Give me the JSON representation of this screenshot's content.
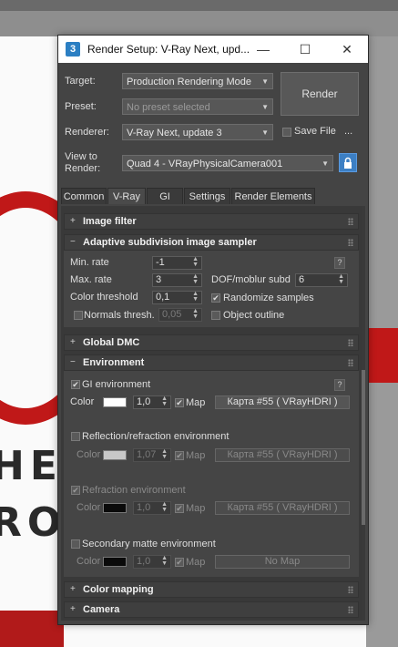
{
  "background": {
    "word_top": "HEL",
    "word_bottom": "ROU"
  },
  "window": {
    "title": "Render Setup: V-Ray Next, upd...",
    "app_icon": "3",
    "controls": {
      "minimize": "—",
      "maximize": "☐",
      "close": "✕"
    }
  },
  "top": {
    "target_label": "Target:",
    "target_value": "Production Rendering Mode",
    "preset_label": "Preset:",
    "preset_value": "No preset selected",
    "renderer_label": "Renderer:",
    "renderer_value": "V-Ray Next, update 3",
    "save_file_label": "Save File",
    "ellipsis": "...",
    "view_label_1": "View to",
    "view_label_2": "Render:",
    "view_value": "Quad 4 - VRayPhysicalCamera001",
    "render_button": "Render",
    "lock_icon": "lock-icon"
  },
  "tabs": [
    {
      "label": "Common",
      "active": false
    },
    {
      "label": "V-Ray",
      "active": true
    },
    {
      "label": "GI",
      "active": false
    },
    {
      "label": "Settings",
      "active": false
    },
    {
      "label": "Render Elements",
      "active": false
    }
  ],
  "rollouts": {
    "image_filter": {
      "sign": "+",
      "title": "Image filter"
    },
    "adaptive": {
      "sign": "−",
      "title": "Adaptive subdivision image sampler",
      "help": "?",
      "min_rate_label": "Min. rate",
      "min_rate_value": "-1",
      "max_rate_label": "Max. rate",
      "max_rate_value": "3",
      "dof_label": "DOF/moblur subd",
      "dof_value": "6",
      "color_threshold_label": "Color threshold",
      "color_threshold_value": "0,1",
      "randomize_label": "Randomize samples",
      "normals_label": "Normals thresh.",
      "normals_value": "0,05",
      "object_outline_label": "Object outline"
    },
    "global_dmc": {
      "sign": "+",
      "title": "Global DMC"
    },
    "environment": {
      "sign": "−",
      "title": "Environment",
      "help": "?",
      "gi_label": "GI environment",
      "gi_color_label": "Color",
      "gi_mult": "1,0",
      "gi_map_label": "Map",
      "gi_map_button": "Карта #55  ( VRayHDRI )",
      "refl_label": "Reflection/refraction environment",
      "refl_color_label": "Color",
      "refl_mult": "1,07",
      "refl_map_label": "Map",
      "refl_map_button": "Карта #55  ( VRayHDRI )",
      "refr_label": "Refraction environment",
      "refr_color_label": "Color",
      "refr_mult": "1,0",
      "refr_map_label": "Map",
      "refr_map_button": "Карта #55  ( VRayHDRI )",
      "matte_label": "Secondary matte environment",
      "matte_color_label": "Color",
      "matte_mult": "1,0",
      "matte_map_label": "Map",
      "matte_map_button": "No Map",
      "colors": {
        "gi": "#ffffff",
        "refl": "#c8c8c8",
        "refr": "#0a0a0a",
        "matte": "#0a0a0a"
      }
    },
    "color_mapping": {
      "sign": "+",
      "title": "Color mapping"
    },
    "camera": {
      "sign": "+",
      "title": "Camera"
    }
  }
}
